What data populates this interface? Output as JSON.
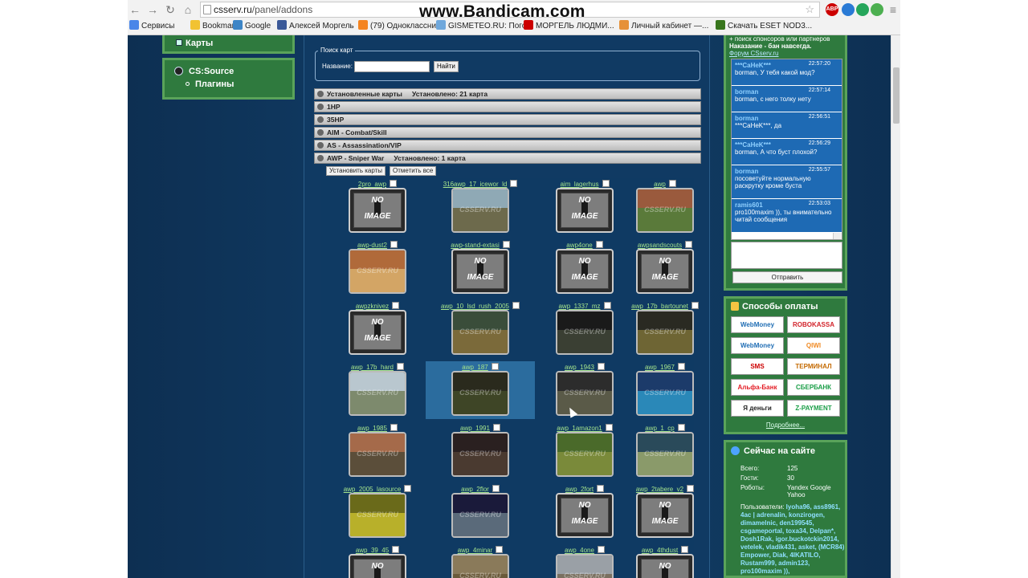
{
  "watermark": "www.Bandicam.com",
  "browser": {
    "url_host": "csserv.ru",
    "url_path": "/panel/addons",
    "bookmarks": [
      {
        "label": "Сервисы",
        "color": "#4a86e8"
      },
      {
        "label": "Bookmarks",
        "color": "#f1c232"
      },
      {
        "label": "Google",
        "color": "#3d85c6"
      },
      {
        "label": "Алексей Моргель",
        "color": "#3b5998"
      },
      {
        "label": "(79) Одноклассники",
        "color": "#f48420"
      },
      {
        "label": "GISMETEO.RU: Пого...",
        "color": "#6fa8dc"
      },
      {
        "label": "МОРГЕЛЬ ЛЮДМИ...",
        "color": "#cc0000"
      },
      {
        "label": "Личный кабинет —...",
        "color": "#e69138"
      },
      {
        "label": "Скачать ESET NOD3...",
        "color": "#38761d"
      }
    ],
    "extensions": [
      {
        "label": "ABP",
        "color": "#c00"
      },
      {
        "label": "",
        "color": "#2a7ad5"
      },
      {
        "label": "",
        "color": "#26a65b"
      },
      {
        "label": "",
        "color": "#4caf50"
      }
    ]
  },
  "left_menu": {
    "maps": "Карты",
    "cs_source": "CS:Source",
    "plugins": "Плагины"
  },
  "search": {
    "legend": "Поиск карт",
    "label": "Название:",
    "value": "",
    "button": "Найти"
  },
  "categories": [
    {
      "name": "Установленные карты",
      "installed": "Установлено: 21 карта"
    },
    {
      "name": "1HP",
      "installed": ""
    },
    {
      "name": "35HP",
      "installed": ""
    },
    {
      "name": "AIM - Combat/Skill",
      "installed": ""
    },
    {
      "name": "AS - Assassination/VIP",
      "installed": ""
    },
    {
      "name": "AWP - Sniper War",
      "installed": "Установлено: 1 карта"
    }
  ],
  "actions": {
    "install": "Установить карты",
    "uncheck": "Отметить все"
  },
  "noimage": {
    "line1": "NO",
    "line2": "IMAGE",
    "wm": "CSSERV.RU"
  },
  "maps": [
    {
      "name": "2pro_awp",
      "noimg": true
    },
    {
      "name": "316awp_17_icewor_ld",
      "noimg": false,
      "sky": "#8fa9b5",
      "gnd": "#6d6a4c"
    },
    {
      "name": "aim_lagerhus",
      "noimg": true
    },
    {
      "name": "awp",
      "noimg": false,
      "sky": "#9a5a3d",
      "gnd": "#5a7a3a"
    },
    {
      "name": "awp-dust2",
      "noimg": false,
      "sky": "#b06a3a",
      "gnd": "#d3a565"
    },
    {
      "name": "awp-stand-extasi",
      "noimg": true
    },
    {
      "name": "awp4one",
      "noimg": true
    },
    {
      "name": "awpsandscouts",
      "noimg": true
    },
    {
      "name": "awpzknivez",
      "noimg": true
    },
    {
      "name": "awp_10_lsd_rush_2005",
      "noimg": false,
      "sky": "#3a4d3a",
      "gnd": "#7b6a3a"
    },
    {
      "name": "awp_1337_mz",
      "noimg": false,
      "sky": "#1a1a1a",
      "gnd": "#3a3f33"
    },
    {
      "name": "awp_17b_bartounet",
      "noimg": false,
      "sky": "#2a2a22",
      "gnd": "#6e6534"
    },
    {
      "name": "awp_17b_hard",
      "noimg": false,
      "sky": "#b9c7cf",
      "gnd": "#7d8a6d"
    },
    {
      "name": "awp_187",
      "noimg": false,
      "sky": "#2a2a1d",
      "gnd": "#3e4526"
    },
    {
      "name": "awp_1943",
      "noimg": false,
      "sky": "#2c2c2c",
      "gnd": "#5a5a48"
    },
    {
      "name": "awp_1967",
      "noimg": false,
      "sky": "#1c3b6a",
      "gnd": "#2a88b8"
    },
    {
      "name": "awp_1985",
      "noimg": false,
      "sky": "#a56a4a",
      "gnd": "#5b4e3a"
    },
    {
      "name": "awp_1991",
      "noimg": false,
      "sky": "#2a2020",
      "gnd": "#4a3a30"
    },
    {
      "name": "awp_1amazon1",
      "noimg": false,
      "sky": "#4a6a2a",
      "gnd": "#7a8a3a"
    },
    {
      "name": "awp_1_cp",
      "noimg": false,
      "sky": "#2a4a5a",
      "gnd": "#8a9a6a"
    },
    {
      "name": "awp_2005_lasource",
      "noimg": false,
      "sky": "#6a6a1a",
      "gnd": "#b8b02a"
    },
    {
      "name": "awp_2flor",
      "noimg": false,
      "sky": "#1a1a3a",
      "gnd": "#5a6a7a"
    },
    {
      "name": "awp_2fort",
      "noimg": true
    },
    {
      "name": "awp_2tabere_v2",
      "noimg": true
    },
    {
      "name": "awp_39_45",
      "noimg": true
    },
    {
      "name": "awp_4minar",
      "noimg": false,
      "sky": "#8a7a5a",
      "gnd": "#6a5a3a"
    },
    {
      "name": "awp_4one",
      "noimg": false,
      "sky": "#9aa0a6",
      "gnd": "#7a7060"
    },
    {
      "name": "awp_4thdust",
      "noimg": true
    }
  ],
  "chat": {
    "notice_line1": "+ поиск спонсоров или партнеров",
    "notice_line2": "Наказание - бан навсегда.",
    "notice_link": "Форум CSserv.ru",
    "messages": [
      {
        "user": "***CaHeK***",
        "time": "22:57:20",
        "text": "borman, У тебя какой мод?"
      },
      {
        "user": "borman",
        "time": "22:57:14",
        "text": "borman, с него толку нету"
      },
      {
        "user": "borman",
        "time": "22:56:51",
        "text": "***CaHeK***, да"
      },
      {
        "user": "***CaHeK***",
        "time": "22:56:29",
        "text": "borman, А что буст плохой?"
      },
      {
        "user": "borman",
        "time": "22:55:57",
        "text": "посоветуйте нормальную раскрутку кроме буста"
      },
      {
        "user": "ramis601",
        "time": "22:53:03",
        "text": "pro100maxim )), ты внимательно читай сообщения"
      }
    ],
    "send": "Отправить"
  },
  "payment": {
    "title": "Способы оплаты",
    "methods": [
      {
        "label": "WebMoney",
        "color": "#1f6db4"
      },
      {
        "label": "ROBOKASSA",
        "color": "#d2232a"
      },
      {
        "label": "WebMoney",
        "color": "#1f6db4"
      },
      {
        "label": "QIWI",
        "color": "#f08a24"
      },
      {
        "label": "SMS",
        "color": "#c00"
      },
      {
        "label": "ТЕРМИНАЛ",
        "color": "#c46a00"
      },
      {
        "label": "Альфа-Банк",
        "color": "#e31b23"
      },
      {
        "label": "СБЕРБАНК",
        "color": "#1a9e47"
      },
      {
        "label": "Я деньги",
        "color": "#222"
      },
      {
        "label": "Z-PAYMENT",
        "color": "#1a9e47"
      }
    ],
    "more": "Подробнее..."
  },
  "online": {
    "title": "Сейчас на сайте",
    "total_label": "Всего:",
    "total": "125",
    "guests_label": "Гости:",
    "guests": "30",
    "robots_label": "Роботы:",
    "robots": "Yandex Google Yahoo",
    "users_label": "Пользователи:",
    "users": "lyoha96, ass8961, 4ac | adrenalin, konzirogen, dimamelnic, den199545, csgameportal, toxa34, Delpan*, Dosh1Rak, igor.buckotckin2014, vetelek, vladik431, asket, (MCR84) Empower, Diak, 4IKATILO, Rustam999, admin123, pro100maxim )),"
  }
}
